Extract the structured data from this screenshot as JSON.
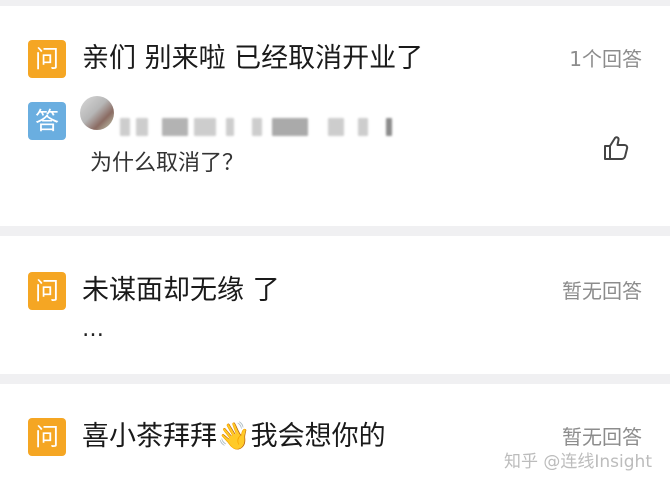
{
  "questions": [
    {
      "badge": "问",
      "text": "亲们 别来啦 已经取消开业了",
      "answer_count": "1个回答",
      "answer": {
        "badge": "答",
        "text": "为什么取消了？"
      }
    },
    {
      "badge": "问",
      "text": "未谋面却无缘 了",
      "extra": "…",
      "answer_count": "暂无回答"
    },
    {
      "badge": "问",
      "text": "喜小茶拜拜👋我会想你的",
      "answer_count": "暂无回答"
    }
  ],
  "watermark": "知乎 @连线Insight",
  "colors": {
    "question_badge": "#f5a623",
    "answer_badge": "#6aaee0",
    "divider": "#f0f0f2"
  },
  "icons": [
    "thumbs-up-icon"
  ]
}
